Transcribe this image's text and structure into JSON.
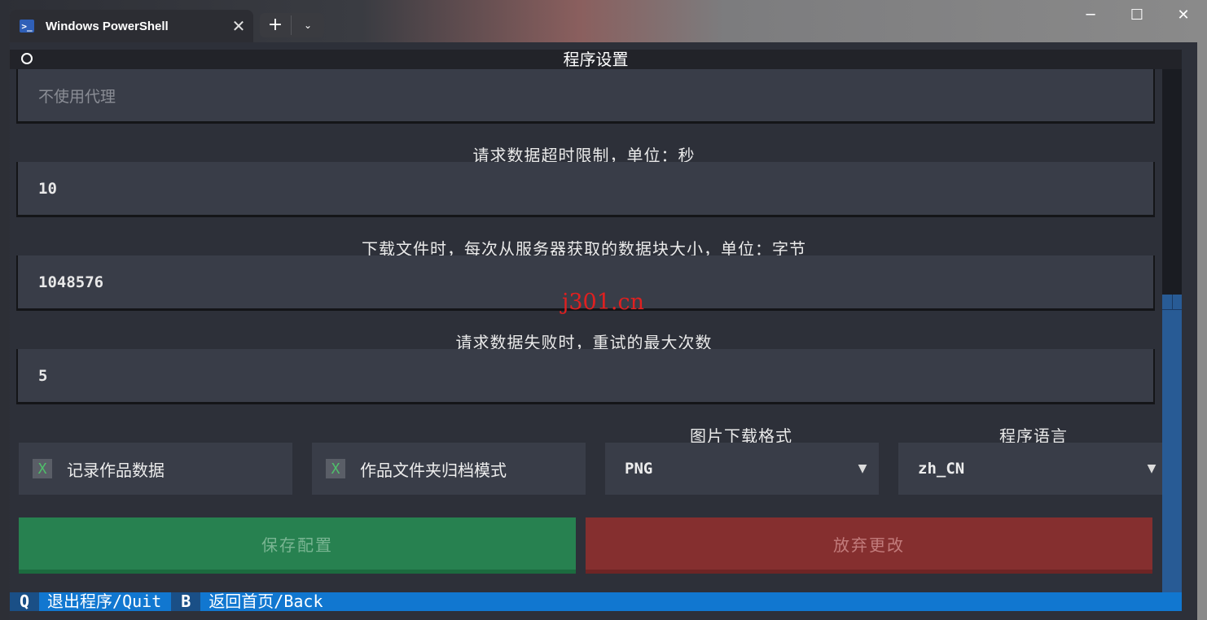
{
  "window": {
    "tab_title": "Windows PowerShell",
    "tab_icon": "powershell-icon",
    "new_tab_glyph": "+",
    "dropdown_glyph": "⌄",
    "close_tab_glyph": "✕",
    "minimize_glyph": "─",
    "maximize_glyph": "☐",
    "close_glyph": "✕"
  },
  "app": {
    "header_title": "程序设置",
    "proxy": {
      "placeholder": "不使用代理",
      "value": ""
    },
    "timeout": {
      "label": "请求数据超时限制，单位：秒",
      "value": "10"
    },
    "chunk": {
      "label": "下载文件时，每次从服务器获取的数据块大小，单位：字节",
      "value": "1048576"
    },
    "retry": {
      "label": "请求数据失败时，重试的最大次数",
      "value": "5"
    },
    "record_data": {
      "mark": "X",
      "label": "记录作品数据",
      "checked": true
    },
    "folder_mode": {
      "mark": "X",
      "label": "作品文件夹归档模式",
      "checked": true
    },
    "image_format": {
      "label": "图片下载格式",
      "value": "PNG"
    },
    "language": {
      "label": "程序语言",
      "value": "zh_CN"
    },
    "select_arrow": "▼",
    "save_button": "保存配置",
    "cancel_button": "放弃更改"
  },
  "footer": [
    {
      "key": "Q",
      "desc": "退出程序/Quit"
    },
    {
      "key": "B",
      "desc": "返回首页/Back"
    }
  ],
  "watermark": "j301.cn",
  "colors": {
    "terminal_bg": "#2d3039",
    "input_bg": "#393d48",
    "save_green": "#278150",
    "cancel_red": "#852f2f",
    "footer_blue": "#1177d0",
    "scroll_thumb": "#285b95"
  }
}
